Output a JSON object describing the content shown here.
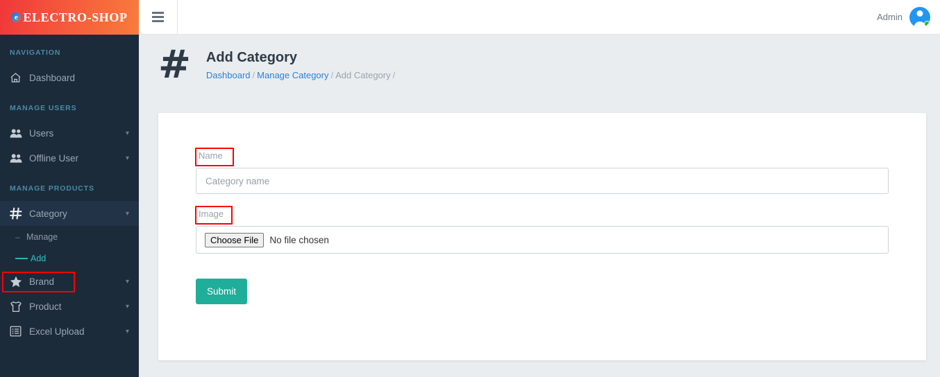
{
  "brand": {
    "logo_text": "ELECTRO-SHOP",
    "logo_mark": "e",
    "accent_start": "#f0373a",
    "accent_end": "#f87c3d"
  },
  "topbar": {
    "menu_icon": "hamburger-icon",
    "admin_label": "Admin",
    "status": "online"
  },
  "sidebar": {
    "sections": [
      {
        "title": "NAVIGATION",
        "items": [
          {
            "label": "Dashboard",
            "icon": "home-icon",
            "expandable": false
          }
        ]
      },
      {
        "title": "MANAGE USERS",
        "items": [
          {
            "label": "Users",
            "icon": "users-icon",
            "expandable": true
          },
          {
            "label": "Offline User",
            "icon": "users-icon",
            "expandable": true
          }
        ]
      },
      {
        "title": "MANAGE PRODUCTS",
        "items": [
          {
            "label": "Category",
            "icon": "hash-icon",
            "expandable": true,
            "active": true,
            "children": [
              {
                "label": "Manage",
                "selected": false
              },
              {
                "label": "Add",
                "selected": true
              }
            ]
          },
          {
            "label": "Brand",
            "icon": "star-icon",
            "expandable": true
          },
          {
            "label": "Product",
            "icon": "shirt-icon",
            "expandable": true
          },
          {
            "label": "Excel Upload",
            "icon": "list-icon",
            "expandable": true
          }
        ]
      }
    ]
  },
  "page": {
    "icon": "#",
    "title": "Add Category",
    "breadcrumb": [
      {
        "label": "Dashboard",
        "link": true
      },
      {
        "label": "Manage Category",
        "link": true
      },
      {
        "label": "Add Category",
        "link": false
      }
    ],
    "separator": "/"
  },
  "form": {
    "name_label": "Name",
    "name_placeholder": "Category name",
    "name_value": "",
    "image_label": "Image",
    "file_button": "Choose File",
    "file_status": "No file chosen",
    "submit_label": "Submit",
    "submit_color": "#1fae9a"
  },
  "highlights": {
    "color": "#ff0000",
    "targets": [
      "sidebar-add-item",
      "name-label",
      "image-label"
    ]
  }
}
